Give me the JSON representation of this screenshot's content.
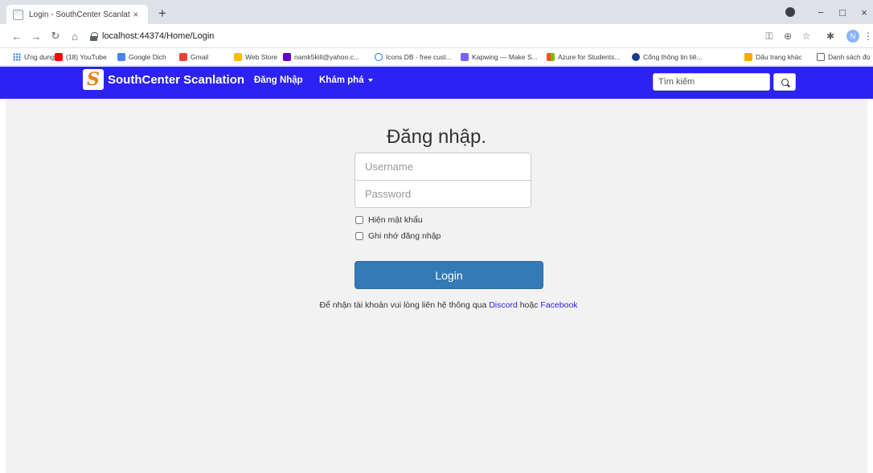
{
  "browser": {
    "tab_title": "Login - SouthCenter Scanlation",
    "tab_close": "×",
    "new_tab": "+",
    "url": "localhost:44374/Home/Login",
    "avatar_letter": "N",
    "controls": {
      "minimize": "−",
      "maximize": "□",
      "close": "×"
    }
  },
  "bookmarks": [
    {
      "label": "Ứng dụng",
      "icon": "apps-grid-icon",
      "color": "#1a73e8"
    },
    {
      "label": "(18) YouTube",
      "icon": "youtube-icon",
      "color": "#ff0000"
    },
    {
      "label": "Google Dịch",
      "icon": "google-translate-icon",
      "color": "#4285f4"
    },
    {
      "label": "Gmail",
      "icon": "gmail-icon",
      "color": "#ea4335"
    },
    {
      "label": "Web Store",
      "icon": "web-store-icon",
      "color": "#fbbc04"
    },
    {
      "label": "namk5kill@yahoo.c...",
      "icon": "mail-icon",
      "color": "#5f01d1"
    },
    {
      "label": "Icons DB - free cust...",
      "icon": "heart-icon",
      "color": "#1a73e8"
    },
    {
      "label": "Kapwing — Make S...",
      "icon": "kapwing-icon",
      "color": "#7b61ff"
    },
    {
      "label": "Azure for Students...",
      "icon": "microsoft-icon",
      "color": "#f25022"
    },
    {
      "label": "Cổng thông tin tiê...",
      "icon": "portal-icon",
      "color": "#1a3a8f"
    },
    {
      "label": "Dấu trang khác",
      "icon": "folder-icon",
      "color": "#f9ab00"
    },
    {
      "label": "Danh sách đọ",
      "icon": "reading-list-icon",
      "color": "#5f6368"
    }
  ],
  "site": {
    "brand_logo": "S",
    "brand_name": "SouthCenter Scanlation",
    "nav_login": "Đăng Nhập",
    "nav_explore": "Khám phá",
    "search_placeholder": "Tìm kiếm",
    "accent_color": "#2b22f3"
  },
  "login": {
    "title": "Đăng nhập.",
    "username_placeholder": "Username",
    "password_placeholder": "Password",
    "show_password": "Hiện mật khẩu",
    "remember_me": "Ghi nhớ đăng nhập",
    "submit": "Login",
    "note_prefix": "Để nhận tài khoản vui lòng liên hệ thông qua",
    "note_discord": "Discord",
    "note_or": "hoặc",
    "note_facebook": "Facebook"
  }
}
